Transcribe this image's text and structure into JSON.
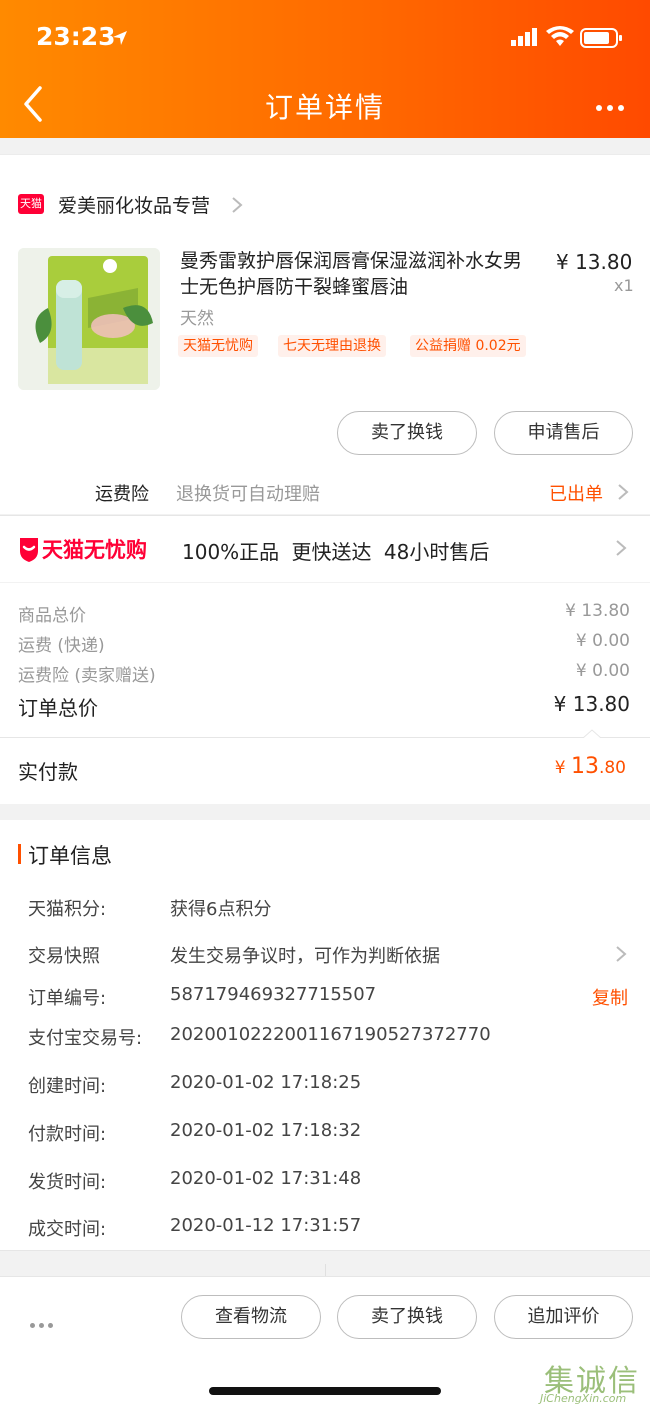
{
  "status_bar": {
    "time": "23:23"
  },
  "header": {
    "title": "订单详情"
  },
  "shop": {
    "badge": "天猫",
    "name": "爱美丽化妆品专营"
  },
  "product": {
    "title": "曼秀雷敦护唇保润唇膏保湿滋润补水女男士无色护唇防干裂蜂蜜唇油",
    "sku": "天然",
    "price": "¥ 13.80",
    "quantity": "x1",
    "tags": [
      "天猫无忧购",
      "七天无理由退换",
      "公益捐赠 0.02元"
    ]
  },
  "item_actions": {
    "sell": "卖了换钱",
    "after_sale": "申请售后"
  },
  "shipping_insurance": {
    "label": "运费险",
    "desc": "退换货可自动理赔",
    "status": "已出单"
  },
  "guarantee": {
    "brand": "天猫无忧购",
    "features": "100%正品  更快送达  48小时售后"
  },
  "pricing": {
    "rows": [
      {
        "label": "商品总价",
        "value": "¥ 13.80"
      },
      {
        "label": "运费 (快递)",
        "value": "¥ 0.00"
      },
      {
        "label": "运费险 (卖家赠送)",
        "value": "¥ 0.00"
      }
    ],
    "total_label": "订单总价",
    "total_value": "¥ 13.80",
    "paid_label": "实付款",
    "paid_currency": "¥ ",
    "paid_int": "13",
    "paid_dec": ".80"
  },
  "order_info": {
    "title": "订单信息",
    "copy_label": "复制",
    "rows": [
      {
        "label": "天猫积分:",
        "value": "获得6点积分"
      },
      {
        "label": "交易快照",
        "value": "发生交易争议时，可作为判断依据"
      },
      {
        "label": "订单编号:",
        "value": "587179469327715507"
      },
      {
        "label": "支付宝交易号:",
        "value": "2020010222001167190527372770"
      },
      {
        "label": "创建时间:",
        "value": "2020-01-02 17:18:25"
      },
      {
        "label": "付款时间:",
        "value": "2020-01-02 17:18:32"
      },
      {
        "label": "发货时间:",
        "value": "2020-01-02 17:31:48"
      },
      {
        "label": "成交时间:",
        "value": "2020-01-12 17:31:57"
      }
    ]
  },
  "bottom_actions": {
    "logistics": "查看物流",
    "sell": "卖了换钱",
    "review": "追加评价"
  },
  "watermark": {
    "cn": "集诚信",
    "en": "JiChengXin.com"
  },
  "colors": {
    "accent": "#ff5000",
    "header_start": "#ff8a00",
    "header_end": "#ff4a00",
    "tmall_red": "#ff0036"
  }
}
